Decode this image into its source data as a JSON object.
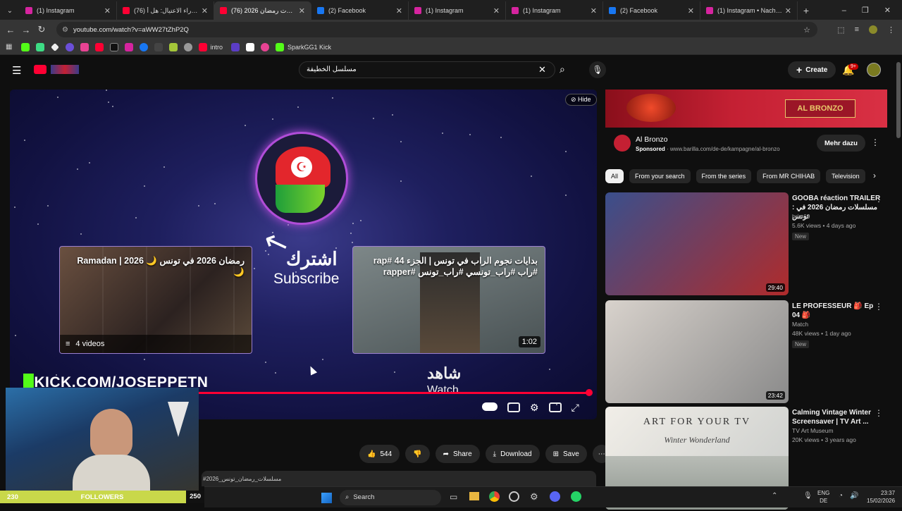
{
  "browser": {
    "tabs": [
      {
        "title": "(1) Instagram",
        "color": "#d6249f",
        "active": false
      },
      {
        "title": "من وراء الاعتيال: هل أ (76)",
        "color": "#ff0033",
        "active": false
      },
      {
        "title": "مسلسلات رمضان 2026 (76)",
        "color": "#ff0033",
        "active": true
      },
      {
        "title": "(2) Facebook",
        "color": "#1877f2",
        "active": false
      },
      {
        "title": "(1) Instagram",
        "color": "#d6249f",
        "active": false
      },
      {
        "title": "(1) Instagram",
        "color": "#d6249f",
        "active": false
      },
      {
        "title": "(2) Facebook",
        "color": "#1877f2",
        "active": false
      },
      {
        "title": "(1) Instagram • Nachricht",
        "color": "#d6249f",
        "active": false
      }
    ],
    "url": "youtube.com/watch?v=aWW27tZhP2Q",
    "bookmarks": [
      {
        "label": "intro"
      },
      {
        "label": "SparkGG1 Kick"
      }
    ]
  },
  "yt": {
    "search_query": "مسلسل الخطيفة",
    "create_label": "Create",
    "notif_count": "9+",
    "player": {
      "hide_label": "Hide",
      "subscribe_ar": "اشترك",
      "subscribe_en": "Subscribe",
      "left_card": {
        "title": "رمضان 2026 في تونس 🌙 Ramadan | 2026 🌙",
        "videos_label": "4 videos"
      },
      "right_card": {
        "title": "بدايات نجوم الراب في تونس | الجزء rap# 44 #راب #راب_تونسي #راب_تونس #rapper",
        "duration": "1:02"
      },
      "watch_ar": "شاهد",
      "watch_en": "Watch",
      "overlay": "KICK.COM/JOSEPPETN"
    },
    "actions": {
      "likes": "544",
      "share": "Share",
      "download": "Download",
      "save": "Save"
    },
    "hashtag": "#مسلسلات_رمضان_تونس_2026",
    "ad": {
      "banner": "AL BRONZO",
      "brand": "Al Bronzo",
      "sponsored": "Sponsored",
      "domain": "www.barilla.com/de-de/kampagne/al-bronzo",
      "cta": "Mehr dazu"
    },
    "chips": [
      "All",
      "From your search",
      "From the series",
      "From MR CHIHAB",
      "Television"
    ],
    "recs": [
      {
        "title": "GOOBA réaction TRAILER : مسلسلات رمضان 2026 في تونس",
        "channel": "briz 69",
        "meta": "5.6K views • 4 days ago",
        "badge": "New",
        "duration": "29:40",
        "c1": "#3a4f8c",
        "c2": "#b02b2b"
      },
      {
        "title": "LE PROFESSEUR 🎒 Ep 04 🎒",
        "channel": "Match",
        "meta": "48K views • 1 day ago",
        "badge": "New",
        "duration": "23:42",
        "c1": "#d8d2cc",
        "c2": "#8a8a8a"
      },
      {
        "title": "Calming Vintage Winter Screensaver | TV Art ...",
        "channel": "TV Art Museum",
        "meta": "20K views • 3 years ago",
        "badge": "",
        "duration": "",
        "c1": "#f1eee8",
        "c2": "#c8cbc9"
      }
    ],
    "art_title": "ART FOR YOUR TV",
    "art_sub": "Winter Wonderland"
  },
  "stream": {
    "followers_left": "230",
    "followers_label": "FOLLOWERS",
    "followers_right": "250"
  },
  "taskbar": {
    "search": "Search",
    "lang1": "ENG",
    "lang2": "DE",
    "time": "23:37",
    "date": "15/02/2026"
  }
}
